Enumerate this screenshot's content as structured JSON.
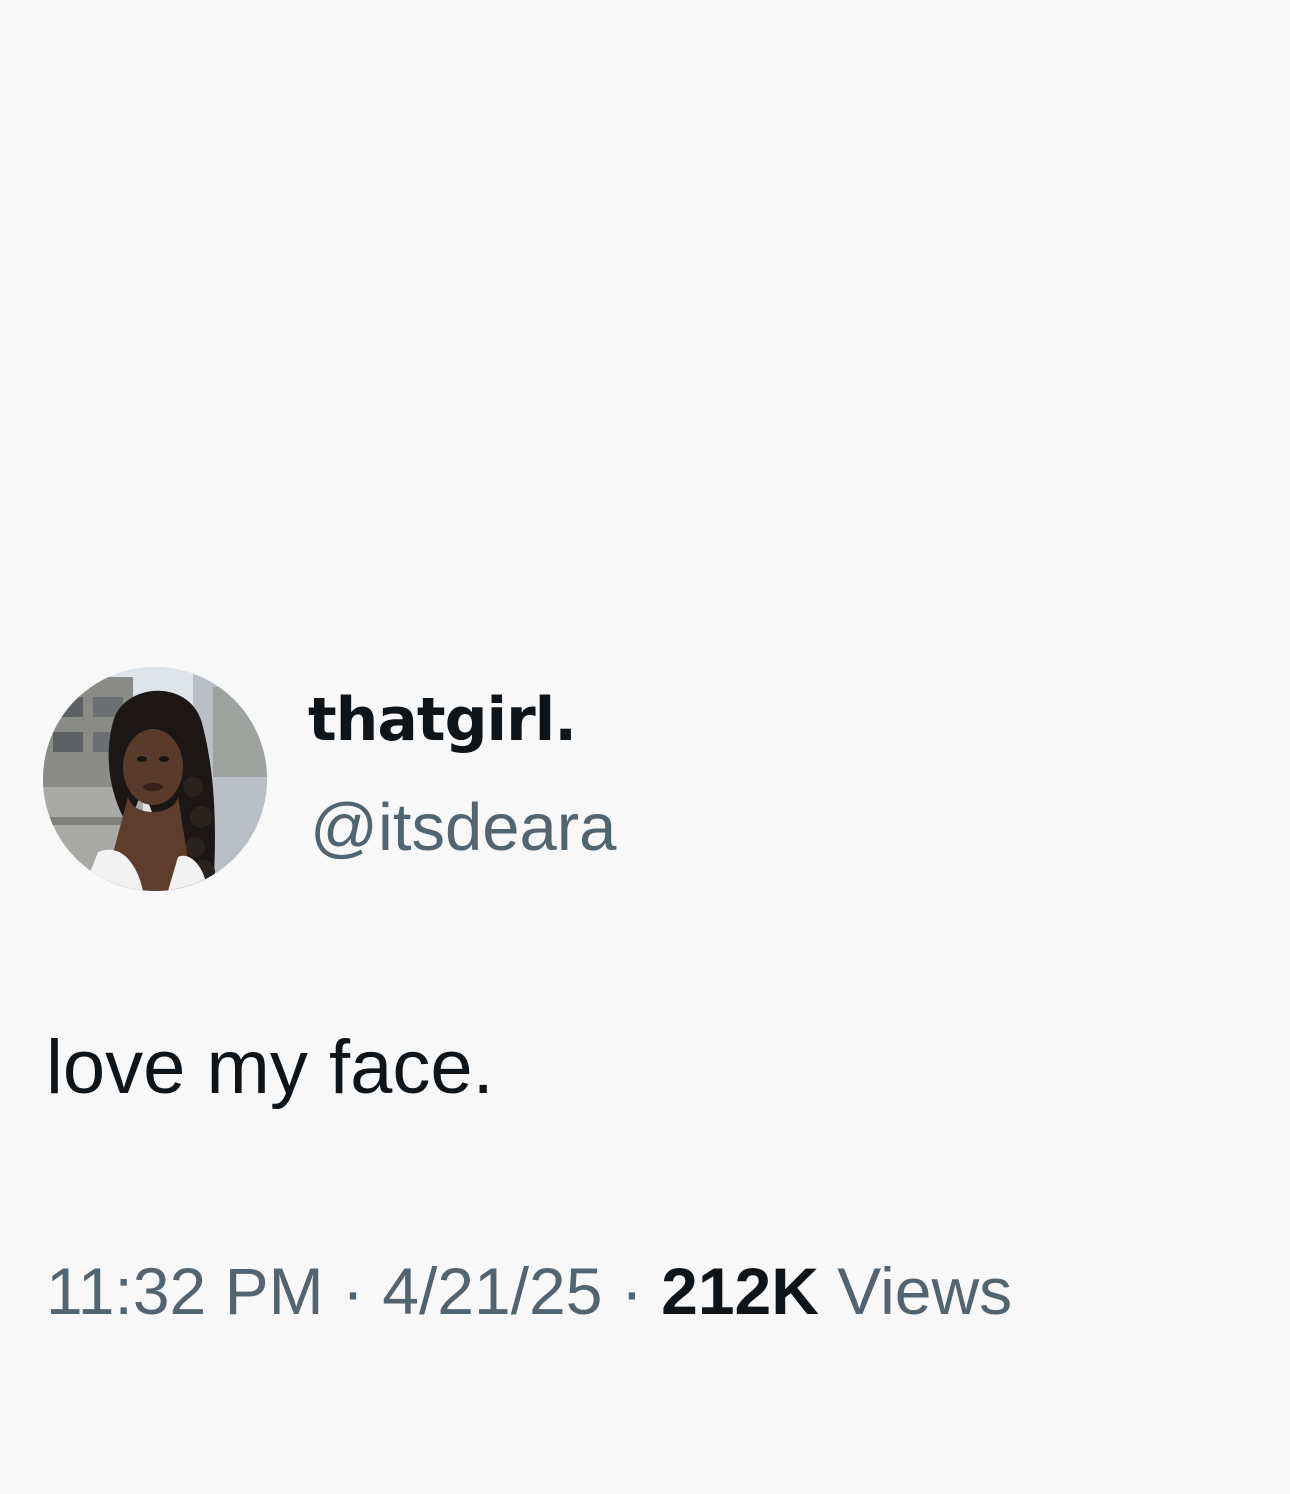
{
  "tweet": {
    "display_name": "thatgirl.",
    "handle": "@itsdeara",
    "text": "love my face.",
    "time": "11:32 PM",
    "separator": " · ",
    "date": "4/21/25",
    "views_count": "212K",
    "views_label": " Views"
  },
  "colors": {
    "background": "#f8f8f9",
    "primary_text": "#0f1419",
    "secondary_text": "#536471"
  }
}
